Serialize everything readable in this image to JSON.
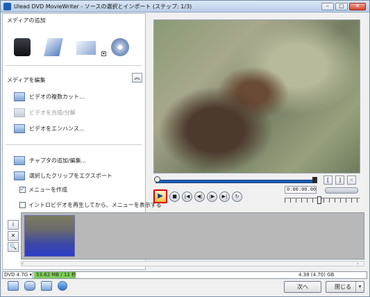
{
  "window": {
    "title": "Ulead DVD MovieWriter - ソースの選択とインポート (ステップ: 1/3)",
    "minimize_icon": "minimize-icon",
    "maximize_icon": "maximize-icon",
    "close_icon": "close-icon"
  },
  "left_panel": {
    "add_media_heading": "メディアの追加",
    "add_media_icons": [
      "camcorder-capture-icon",
      "import-video-icon",
      "import-photo-icon",
      "import-disc-icon"
    ],
    "edit_media_heading": "メディアを編集",
    "collapse_icon": "double-chevron-up-icon",
    "edit_tasks": [
      {
        "label": "ビデオの複数カット...",
        "enabled": true
      },
      {
        "label": "ビデオを合成/分解",
        "enabled": false
      },
      {
        "label": "ビデオをエンハンス...",
        "enabled": true
      }
    ],
    "menu_tasks": [
      {
        "label": "チャプタの追加/編集..."
      },
      {
        "label": "選択したクリップをエクスポート"
      }
    ],
    "checkboxes": [
      {
        "label": "メニューを作成",
        "checked": true
      },
      {
        "label": "イントロビデオを再生してから、メニューを表示する",
        "checked": false
      }
    ]
  },
  "player": {
    "mark_in_label": "[",
    "mark_out_label": "]",
    "timecode": "0:00:00.00",
    "transport_icons": [
      "play-icon",
      "stop-icon",
      "go-to-start-icon",
      "previous-frame-icon",
      "next-frame-icon",
      "go-to-end-icon",
      "repeat-icon"
    ],
    "play_glyph": "▶",
    "stop_glyph": "■",
    "start_glyph": "|◀",
    "prev_glyph": "◀|",
    "next_glyph": "|▶",
    "end_glyph": "▶|",
    "repeat_glyph": "↻"
  },
  "clip_toolbar": {
    "info_glyph": "i",
    "remove_glyph": "✕",
    "zoom_glyph": "🔍"
  },
  "status": {
    "disc_type": "DVD 4.7G",
    "used": "53.62 MB / 12 秒",
    "capacity": "4.38 (4.70) GB",
    "usage_fraction": 0.012
  },
  "buttons": {
    "next": "次へ",
    "close": "閉じる"
  }
}
